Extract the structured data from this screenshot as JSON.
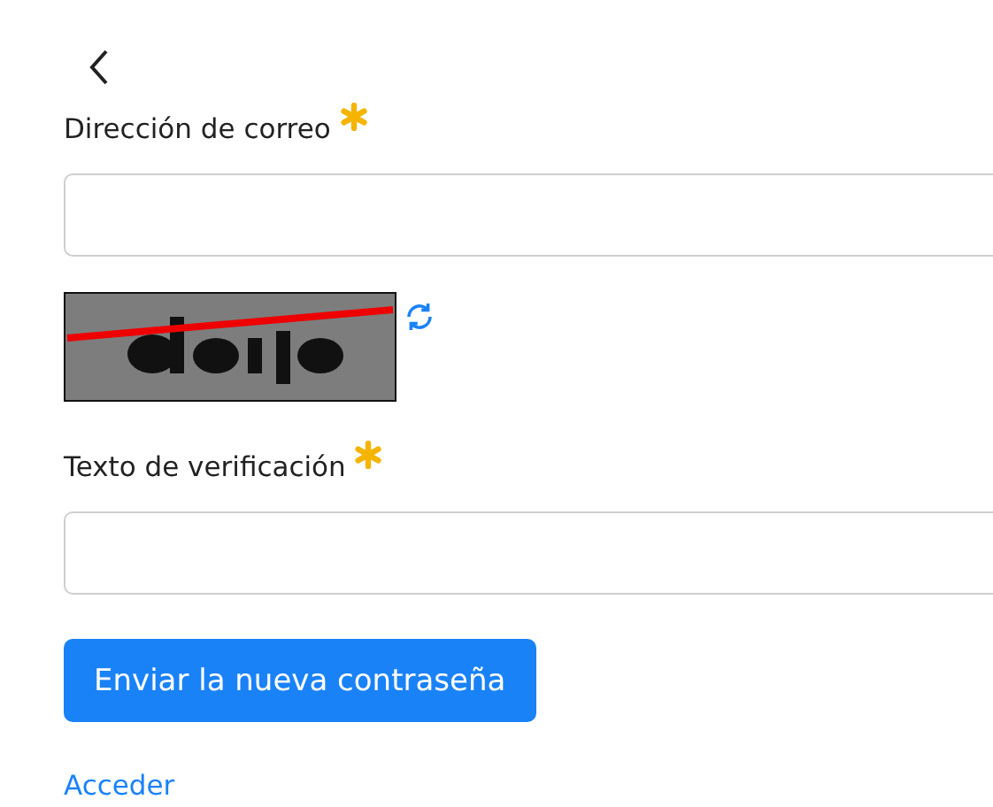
{
  "fields": [
    {
      "label": "Dirección de correo",
      "required": true,
      "kind": "text"
    },
    {
      "kind": "captcha"
    },
    {
      "label": "Texto de verificación",
      "required": true,
      "kind": "text"
    }
  ],
  "submit_button": {
    "label": "Enviar la nueva contraseña"
  },
  "login_link": {
    "label": "Acceder"
  }
}
